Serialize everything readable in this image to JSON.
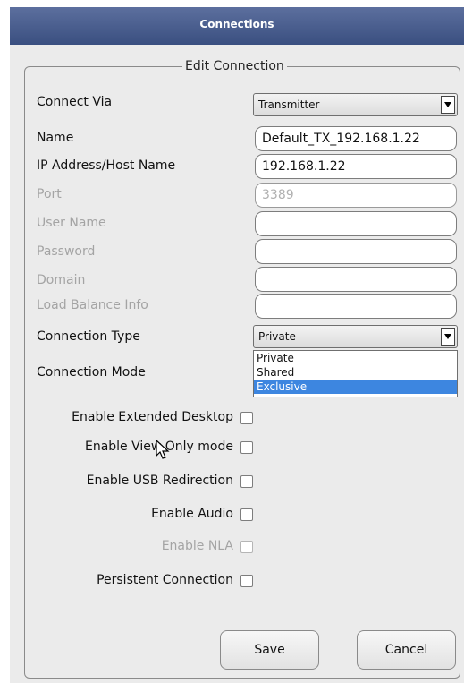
{
  "window": {
    "title": "Connections"
  },
  "group": {
    "legend": "Edit Connection"
  },
  "form": {
    "connect_via": {
      "label": "Connect Via",
      "value": "Transmitter"
    },
    "name": {
      "label": "Name",
      "value": "Default_TX_192.168.1.22"
    },
    "ip": {
      "label": "IP Address/Host Name",
      "value": "192.168.1.22"
    },
    "port": {
      "label": "Port",
      "placeholder": "3389"
    },
    "user_name": {
      "label": "User Name",
      "value": ""
    },
    "password": {
      "label": "Password",
      "value": ""
    },
    "domain": {
      "label": "Domain",
      "value": ""
    },
    "load_balance": {
      "label": "Load Balance Info",
      "value": ""
    },
    "connection_type": {
      "label": "Connection Type",
      "value": "Private",
      "options": [
        "Private",
        "Shared",
        "Exclusive"
      ],
      "highlighted": "Exclusive"
    },
    "connection_mode": {
      "label": "Connection Mode"
    }
  },
  "checkboxes": {
    "extended_desktop": "Enable Extended Desktop",
    "view_only": "Enable View Only mode",
    "usb_redirection": "Enable USB Redirection",
    "audio": "Enable Audio",
    "nla": "Enable NLA",
    "persistent": "Persistent Connection"
  },
  "buttons": {
    "save": "Save",
    "cancel": "Cancel"
  },
  "colors": {
    "title_bar": "#3a4f80",
    "highlight": "#3d86e0",
    "background": "#ebebeb"
  }
}
